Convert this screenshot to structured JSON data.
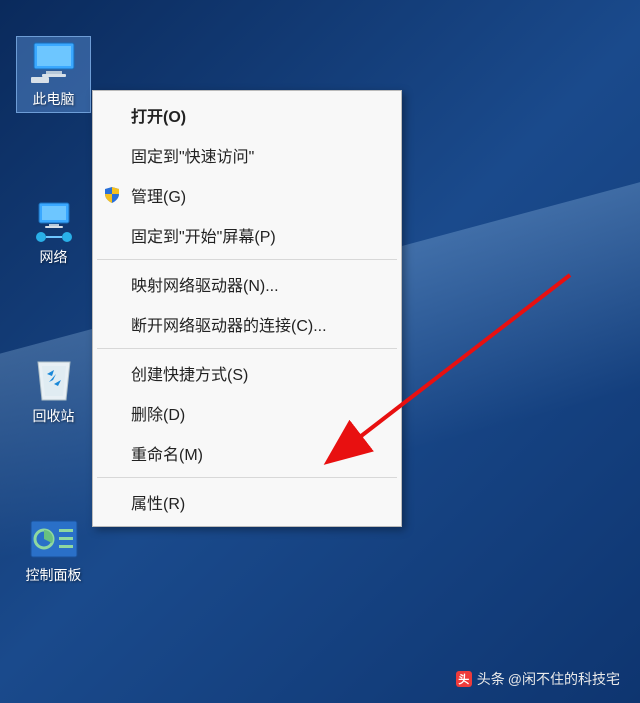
{
  "desktop": {
    "icon_this_pc": "此电脑",
    "icon_network": "网络",
    "icon_recycle": "回收站",
    "icon_control_panel": "控制面板"
  },
  "context_menu": {
    "open": "打开(O)",
    "pin_quick_access": "固定到\"快速访问\"",
    "manage": "管理(G)",
    "pin_start": "固定到\"开始\"屏幕(P)",
    "map_drive": "映射网络驱动器(N)...",
    "disconnect_drive": "断开网络驱动器的连接(C)...",
    "create_shortcut": "创建快捷方式(S)",
    "delete": "删除(D)",
    "rename": "重命名(M)",
    "properties": "属性(R)"
  },
  "watermark": {
    "prefix": "头条",
    "author": "@闲不住的科技宅"
  }
}
